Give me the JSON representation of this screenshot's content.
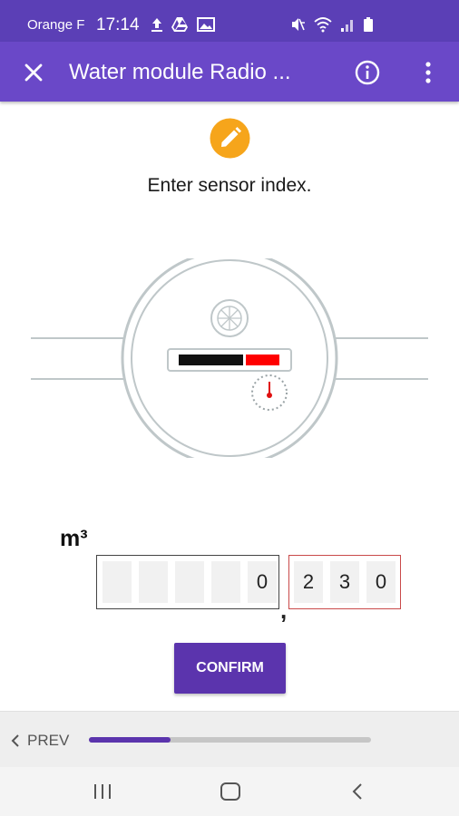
{
  "status_bar": {
    "carrier": "Orange F",
    "time": "17:14",
    "icons": [
      "upload-icon",
      "drive-icon",
      "gallery-icon",
      "mute-icon",
      "wifi-icon",
      "signal-icon",
      "battery-icon"
    ]
  },
  "app_bar": {
    "title": "Water module Radio ...",
    "icons": [
      "close-icon",
      "info-icon",
      "more-vert-icon"
    ]
  },
  "main": {
    "edit_icon": "pencil-icon",
    "instruction": "Enter sensor index.",
    "meter_illustration": "water-meter-icon",
    "unit": "m³",
    "index_integer_digits": [
      "",
      "",
      "",
      "",
      "0"
    ],
    "comma": ",",
    "index_decimal_digits": [
      "2",
      "3",
      "0"
    ],
    "confirm_label": "CONFIRM"
  },
  "bottom_bar": {
    "prev_label": "PREV",
    "progress_fraction": 0.29
  },
  "colors": {
    "status_bar": "#5b3fb6",
    "app_bar": "#6a48c8",
    "accent_button": "#5b34ad",
    "edit_icon": "#f6a51b",
    "decimal_border": "#c94a4a",
    "meter_red": "#ff0000"
  }
}
